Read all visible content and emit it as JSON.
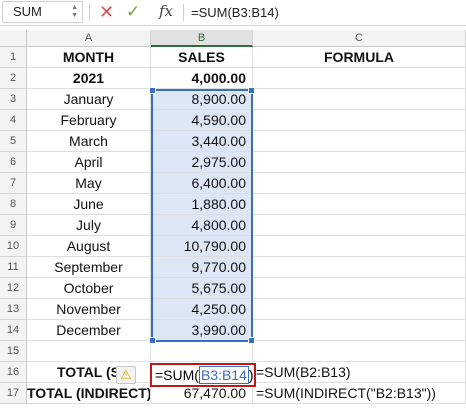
{
  "formula_bar": {
    "name_box": "SUM",
    "cancel": "✕",
    "enter": "✓",
    "fx": "fx",
    "formula": "=SUM(B3:B14)"
  },
  "columns": [
    "A",
    "B",
    "C"
  ],
  "rows": [
    {
      "n": "1",
      "a": "MONTH",
      "b": "SALES",
      "c": "FORMULA"
    },
    {
      "n": "2",
      "a": "2021",
      "b": "4,000.00",
      "c": ""
    },
    {
      "n": "3",
      "a": "January",
      "b": "8,900.00",
      "c": ""
    },
    {
      "n": "4",
      "a": "February",
      "b": "4,590.00",
      "c": ""
    },
    {
      "n": "5",
      "a": "March",
      "b": "3,440.00",
      "c": ""
    },
    {
      "n": "6",
      "a": "April",
      "b": "2,975.00",
      "c": ""
    },
    {
      "n": "7",
      "a": "May",
      "b": "6,400.00",
      "c": ""
    },
    {
      "n": "8",
      "a": "June",
      "b": "1,880.00",
      "c": ""
    },
    {
      "n": "9",
      "a": "July",
      "b": "4,800.00",
      "c": ""
    },
    {
      "n": "10",
      "a": "August",
      "b": "10,790.00",
      "c": ""
    },
    {
      "n": "11",
      "a": "September",
      "b": "9,770.00",
      "c": ""
    },
    {
      "n": "12",
      "a": "October",
      "b": "5,675.00",
      "c": ""
    },
    {
      "n": "13",
      "a": "November",
      "b": "4,250.00",
      "c": ""
    },
    {
      "n": "14",
      "a": "December",
      "b": "3,990.00",
      "c": ""
    },
    {
      "n": "15",
      "a": "",
      "b": "",
      "c": ""
    },
    {
      "n": "16",
      "a": "TOTAL (S",
      "b": "",
      "c": "=SUM(B2:B13)"
    },
    {
      "n": "17",
      "a": "TOTAL (INDIRECT)",
      "b": "67,470.00",
      "c": "=SUM(INDIRECT(\"B2:B13\"))"
    }
  ],
  "editing_cell": {
    "prefix": "=SUM(",
    "ref": "B3:B14",
    "suffix": ")"
  },
  "warning_icon": "⚠",
  "colors": {
    "selection_outline": "#3a6dbf",
    "selection_fill": "#dce6f4",
    "edit_border": "#c0171a"
  }
}
